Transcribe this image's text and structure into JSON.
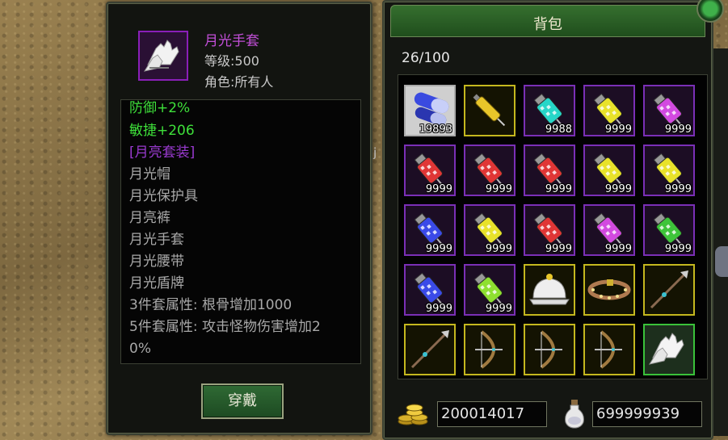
{
  "item_tooltip": {
    "name": "月光手套",
    "level": "等级:500",
    "role": "角色:所有人",
    "lines": [
      {
        "text": "防御+2%",
        "color": "green"
      },
      {
        "text": "敏捷+206",
        "color": "green"
      },
      {
        "text": "[月亮套装]",
        "color": "purple"
      },
      {
        "text": "月光帽",
        "color": "grey"
      },
      {
        "text": "月光保护具",
        "color": "grey"
      },
      {
        "text": "月亮裤",
        "color": "grey"
      },
      {
        "text": "月光手套",
        "color": "grey"
      },
      {
        "text": "月光腰带",
        "color": "grey"
      },
      {
        "text": "月光盾牌",
        "color": "grey"
      },
      {
        "text": "3件套属性: 根骨增加1000",
        "color": "grey"
      },
      {
        "text": "5件套属性: 攻击怪物伤害增加2",
        "color": "grey"
      },
      {
        "text": "0%",
        "color": "grey"
      }
    ],
    "equip_label": "穿戴"
  },
  "backpack": {
    "title": "背包",
    "capacity": "26/100",
    "slots": [
      {
        "icon": "capsule-pill",
        "qty": "19893",
        "frame": "grey"
      },
      {
        "icon": "gold-syringe",
        "qty": "",
        "frame": "gold"
      },
      {
        "icon": "cyan-potion",
        "qty": "9988",
        "frame": "purple"
      },
      {
        "icon": "yellow-potion",
        "qty": "9999",
        "frame": "purple"
      },
      {
        "icon": "violet-potion",
        "qty": "9999",
        "frame": "purple"
      },
      {
        "icon": "red-potion",
        "qty": "9999",
        "frame": "purple"
      },
      {
        "icon": "red-potion",
        "qty": "9999",
        "frame": "purple"
      },
      {
        "icon": "red-potion",
        "qty": "9999",
        "frame": "purple"
      },
      {
        "icon": "yellow-potion",
        "qty": "9999",
        "frame": "purple"
      },
      {
        "icon": "yellow-potion",
        "qty": "9999",
        "frame": "purple"
      },
      {
        "icon": "blue-potion",
        "qty": "9999",
        "frame": "purple"
      },
      {
        "icon": "yellow-potion",
        "qty": "9999",
        "frame": "purple"
      },
      {
        "icon": "red-potion",
        "qty": "9999",
        "frame": "purple"
      },
      {
        "icon": "violet-potion",
        "qty": "9999",
        "frame": "purple"
      },
      {
        "icon": "green-potion",
        "qty": "9999",
        "frame": "purple"
      },
      {
        "icon": "blue-potion",
        "qty": "9999",
        "frame": "purple"
      },
      {
        "icon": "lime-potion",
        "qty": "9999",
        "frame": "purple"
      },
      {
        "icon": "white-helmet",
        "qty": "",
        "frame": "gold"
      },
      {
        "icon": "studded-belt",
        "qty": "",
        "frame": "gold"
      },
      {
        "icon": "spear",
        "qty": "",
        "frame": "gold"
      },
      {
        "icon": "sword",
        "qty": "",
        "frame": "gold"
      },
      {
        "icon": "crossbow",
        "qty": "",
        "frame": "gold"
      },
      {
        "icon": "bow",
        "qty": "",
        "frame": "gold"
      },
      {
        "icon": "bow",
        "qty": "",
        "frame": "gold"
      },
      {
        "icon": "white-gloves",
        "qty": "",
        "frame": "selected"
      }
    ],
    "gold": "200014017",
    "potion_currency": "699999939"
  },
  "colors": {
    "green": "#3ee03a",
    "purple": "#9a3ad0",
    "grey": "#a8a8a8",
    "frame_purple": "#7a2fb6",
    "frame_gold": "#c4b71e",
    "frame_selected": "#3ac23a"
  },
  "background_glimpse": "j"
}
